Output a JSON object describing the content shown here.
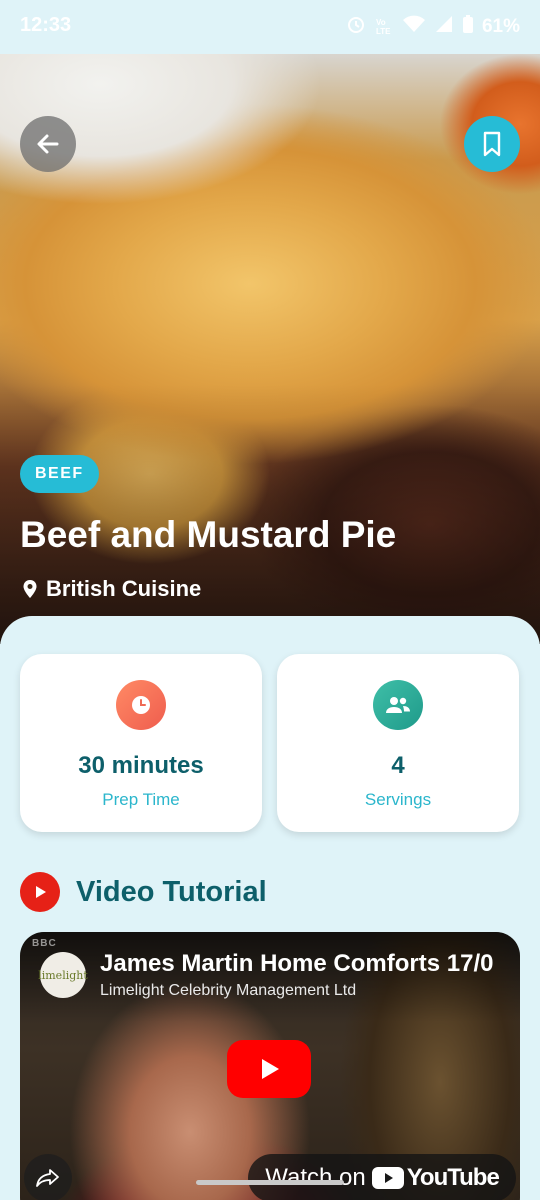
{
  "status_bar": {
    "time": "12:33",
    "battery": "61%",
    "icons": [
      "alarm-icon",
      "volte-icon",
      "wifi-icon",
      "signal-icon",
      "battery-icon"
    ]
  },
  "hero": {
    "category": "BEEF",
    "title": "Beef and Mustard Pie",
    "cuisine": "British Cuisine",
    "accent_color": "#26bcd6"
  },
  "info_cards": [
    {
      "icon": "clock-icon",
      "value": "30 minutes",
      "label": "Prep Time",
      "color": "#ef6a55"
    },
    {
      "icon": "people-icon",
      "value": "4",
      "label": "Servings",
      "color": "#27a893"
    }
  ],
  "video_section": {
    "heading": "Video Tutorial",
    "video": {
      "title": "James Martin Home Comforts 17/0",
      "channel": "Limelight Celebrity Management Ltd",
      "channel_logo_text": "limelight",
      "watermark": "BBC",
      "watch_label": "Watch on",
      "platform": "YouTube"
    }
  }
}
